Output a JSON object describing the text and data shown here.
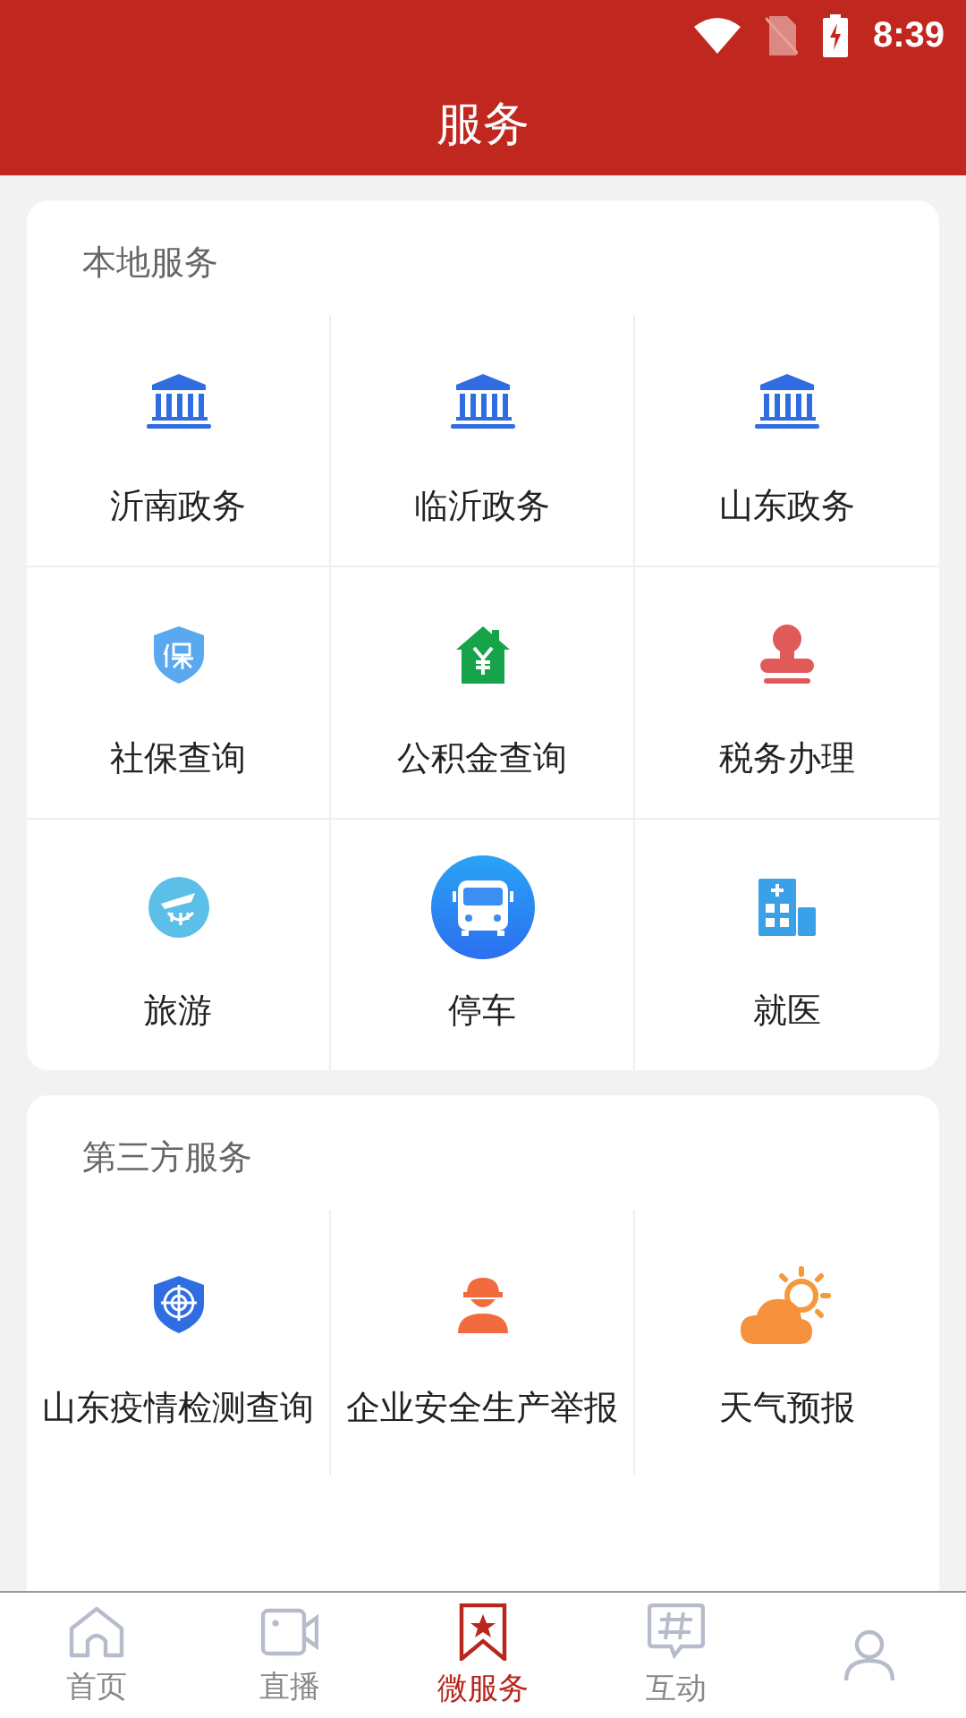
{
  "status_bar": {
    "time": "8:39"
  },
  "header": {
    "title": "服务"
  },
  "sections": [
    {
      "title": "本地服务",
      "items": [
        {
          "label": "沂南政务"
        },
        {
          "label": "临沂政务"
        },
        {
          "label": "山东政务"
        },
        {
          "label": "社保查询"
        },
        {
          "label": "公积金查询"
        },
        {
          "label": "税务办理"
        },
        {
          "label": "旅游"
        },
        {
          "label": "停车"
        },
        {
          "label": "就医"
        }
      ]
    },
    {
      "title": "第三方服务",
      "items": [
        {
          "label": "山东疫情检测查询"
        },
        {
          "label": "企业安全生产举报"
        },
        {
          "label": "天气预报"
        }
      ]
    }
  ],
  "tab_bar": [
    {
      "label": "首页",
      "selected": false
    },
    {
      "label": "直播",
      "selected": false
    },
    {
      "label": "微服务",
      "selected": true
    },
    {
      "label": "互动",
      "selected": false
    }
  ]
}
